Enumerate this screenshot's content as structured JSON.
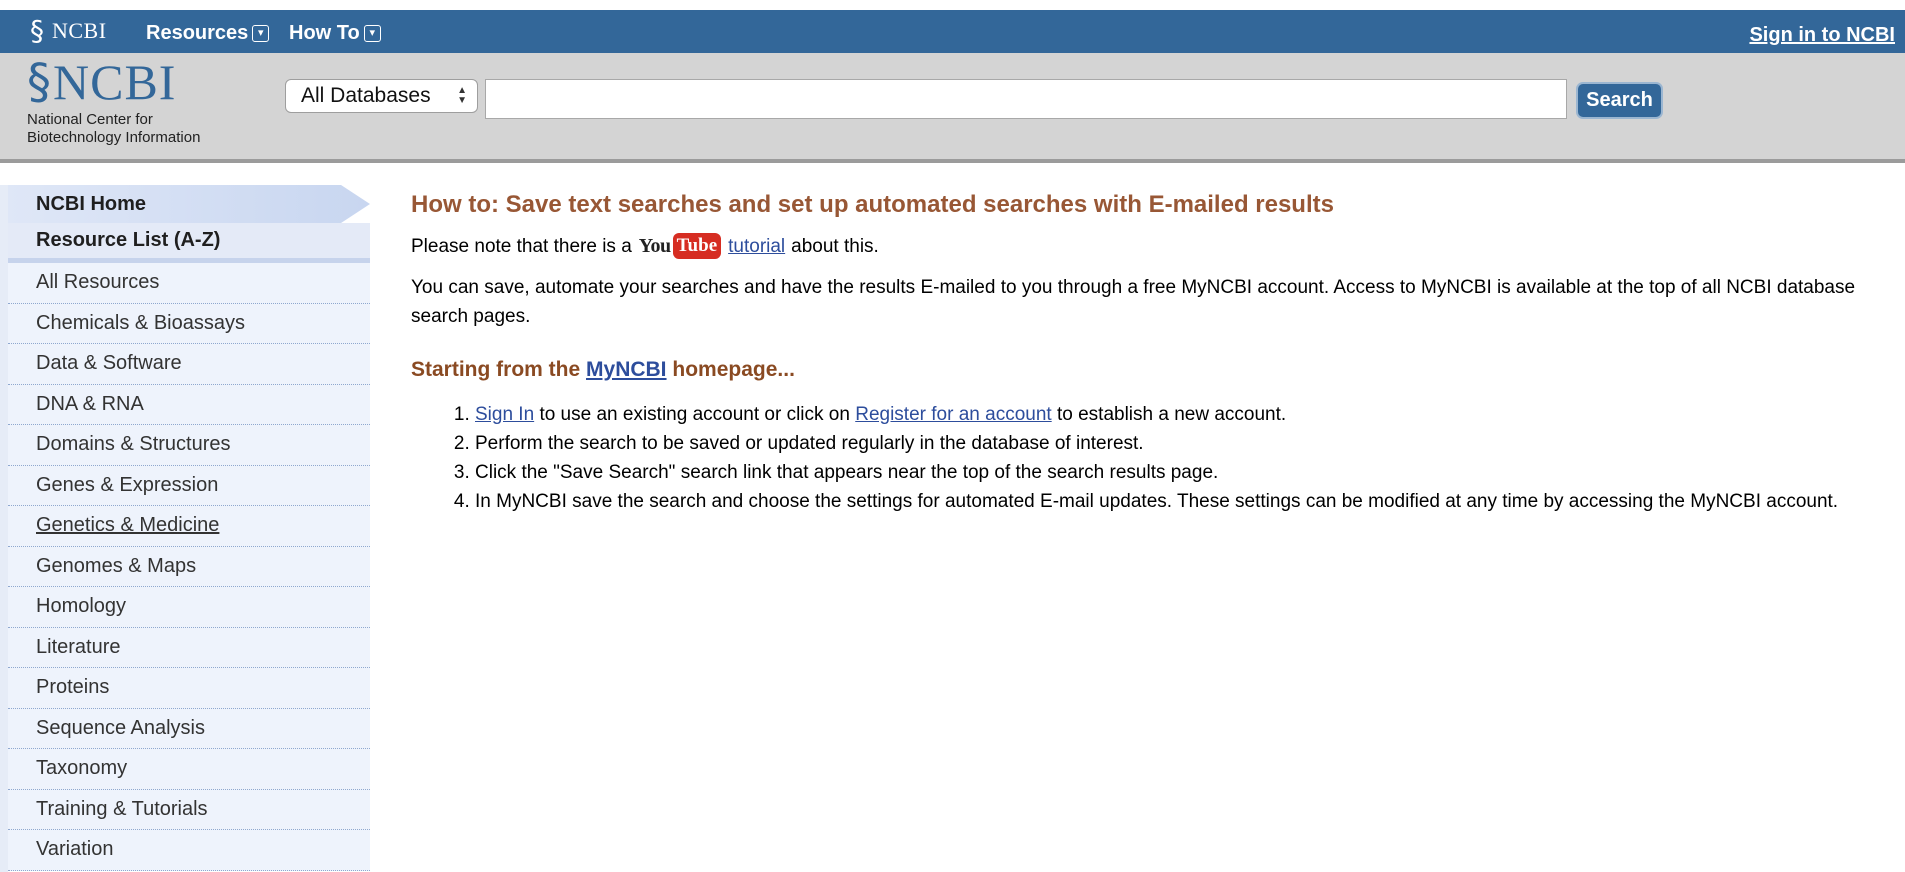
{
  "topbar": {
    "brand": "NCBI",
    "menu_resources": "Resources",
    "menu_howto": "How To",
    "signin": "Sign in to NCBI"
  },
  "header": {
    "logo_text": "NCBI",
    "logo_sub_line1": "National Center for",
    "logo_sub_line2": "Biotechnology Information",
    "db_selected": "All Databases",
    "search_value": "",
    "search_button": "Search"
  },
  "sidebar": {
    "home": "NCBI Home",
    "az": "Resource List (A-Z)",
    "items": [
      {
        "label": "All Resources"
      },
      {
        "label": "Chemicals & Bioassays"
      },
      {
        "label": "Data & Software"
      },
      {
        "label": "DNA & RNA"
      },
      {
        "label": "Domains & Structures"
      },
      {
        "label": "Genes & Expression"
      },
      {
        "label": "Genetics & Medicine"
      },
      {
        "label": "Genomes & Maps"
      },
      {
        "label": "Homology"
      },
      {
        "label": "Literature"
      },
      {
        "label": "Proteins"
      },
      {
        "label": "Sequence Analysis"
      },
      {
        "label": "Taxonomy"
      },
      {
        "label": "Training & Tutorials"
      },
      {
        "label": "Variation"
      }
    ]
  },
  "main": {
    "title": "How to: Save text searches and set up automated searches with E-mailed results",
    "note_prefix": "Please note that there is a",
    "yt_you": "You",
    "yt_tube": "Tube",
    "note_link": "tutorial",
    "note_suffix": "about this.",
    "para": "You can save, automate your searches and have the results E-mailed to you through a free MyNCBI account. Access to MyNCBI is available at the top of all NCBI database search pages.",
    "subheading_prefix": "Starting from the",
    "subheading_link": "MyNCBI",
    "subheading_suffix": "homepage...",
    "step1_link1": "Sign In",
    "step1_mid": "to use an existing account or click on",
    "step1_link2": "Register for an account",
    "step1_end": "to establish a new account.",
    "step2": "Perform the search to be saved or updated regularly in the database of interest.",
    "step3": "Click the \"Save Search\" search link that appears near the top of the search results page.",
    "step4": "In MyNCBI save the search and choose the settings for automated E-mail updates. These settings can be modified at any time by accessing the MyNCBI account."
  },
  "colors": {
    "topbar": "#336799",
    "header": "#d4d4d4",
    "title": "#985735",
    "link": "#2d4d9c"
  }
}
